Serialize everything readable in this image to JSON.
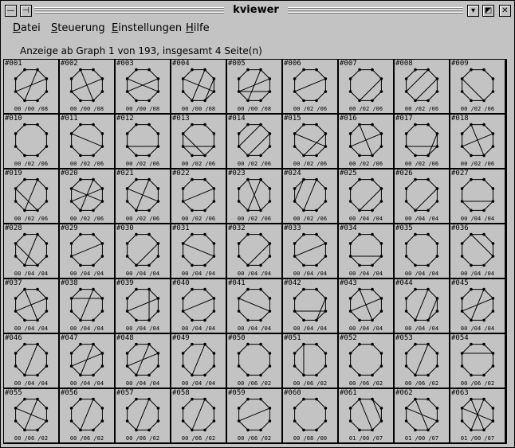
{
  "window": {
    "title": "kviewer"
  },
  "menu": [
    "Datei",
    "Steuerung",
    "Einstellungen",
    "Hilfe"
  ],
  "status": "Anzeige ab Graph 1 von 193, insgesamt 4 Seite(n)",
  "graphs": [
    {
      "label": "#001",
      "caption": "00 /00 /08",
      "edges": [
        [
          0,
          4
        ],
        [
          1,
          5
        ]
      ]
    },
    {
      "label": "#002",
      "caption": "00 /00 /08",
      "edges": [
        [
          1,
          5
        ],
        [
          3,
          7
        ]
      ]
    },
    {
      "label": "#003",
      "caption": "00 /00 /08",
      "edges": [
        [
          2,
          6
        ],
        [
          1,
          5
        ]
      ]
    },
    {
      "label": "#004",
      "caption": "00 /00 /08",
      "edges": [
        [
          0,
          4
        ],
        [
          2,
          6
        ],
        [
          1,
          3
        ]
      ]
    },
    {
      "label": "#005",
      "caption": "00 /00 /08",
      "edges": [
        [
          1,
          5
        ],
        [
          0,
          4
        ],
        [
          2,
          5
        ]
      ]
    },
    {
      "label": "#006",
      "caption": "00 /02 /06",
      "edges": [
        [
          1,
          5
        ]
      ]
    },
    {
      "label": "#007",
      "caption": "00 /02 /06",
      "edges": [
        [
          1,
          4
        ]
      ]
    },
    {
      "label": "#008",
      "caption": "00 /02 /06",
      "edges": [
        [
          1,
          4
        ],
        [
          0,
          5
        ]
      ]
    },
    {
      "label": "#009",
      "caption": "00 /02 /06",
      "edges": [
        [
          6,
          3
        ]
      ]
    },
    {
      "label": "#010",
      "caption": "00 /02 /06",
      "edges": []
    },
    {
      "label": "#011",
      "caption": "00 /02 /06",
      "edges": [
        [
          2,
          6
        ]
      ]
    },
    {
      "label": "#012",
      "caption": "00 /02 /06",
      "edges": [
        [
          2,
          5
        ]
      ]
    },
    {
      "label": "#013",
      "caption": "00 /02 /06",
      "edges": [
        [
          2,
          5
        ],
        [
          6,
          3
        ]
      ]
    },
    {
      "label": "#014",
      "caption": "00 /02 /06",
      "edges": [
        [
          0,
          5
        ],
        [
          1,
          4
        ]
      ]
    },
    {
      "label": "#015",
      "caption": "00 /02 /06",
      "edges": [
        [
          2,
          6
        ],
        [
          1,
          4
        ]
      ]
    },
    {
      "label": "#016",
      "caption": "00 /02 /06",
      "edges": [
        [
          1,
          5
        ],
        [
          7,
          3
        ]
      ]
    },
    {
      "label": "#017",
      "caption": "00 /02 /06",
      "edges": [
        [
          2,
          5
        ],
        [
          1,
          3
        ]
      ]
    },
    {
      "label": "#018",
      "caption": "00 /02 /06",
      "edges": [
        [
          1,
          5
        ],
        [
          7,
          3
        ]
      ]
    },
    {
      "label": "#019",
      "caption": "00 /02 /06",
      "edges": [
        [
          0,
          4
        ],
        [
          6,
          3
        ]
      ]
    },
    {
      "label": "#020",
      "caption": "00 /02 /06",
      "edges": [
        [
          2,
          6
        ],
        [
          1,
          5
        ],
        [
          0,
          4
        ]
      ]
    },
    {
      "label": "#021",
      "caption": "00 /02 /06",
      "edges": [
        [
          2,
          6
        ],
        [
          0,
          4
        ]
      ]
    },
    {
      "label": "#022",
      "caption": "00 /02 /06",
      "edges": [
        [
          1,
          5
        ]
      ]
    },
    {
      "label": "#023",
      "caption": "00 /02 /06",
      "edges": [
        [
          0,
          4
        ],
        [
          7,
          3
        ]
      ]
    },
    {
      "label": "#024",
      "caption": "00 /02 /06",
      "edges": [
        [
          0,
          4
        ],
        [
          7,
          5
        ]
      ]
    },
    {
      "label": "#025",
      "caption": "00 /04 /04",
      "edges": [
        [
          1,
          4
        ]
      ]
    },
    {
      "label": "#026",
      "caption": "00 /04 /04",
      "edges": [
        [
          1,
          4
        ]
      ]
    },
    {
      "label": "#027",
      "caption": "00 /04 /04",
      "edges": [
        [
          2,
          5
        ]
      ]
    },
    {
      "label": "#028",
      "caption": "00 /04 /04",
      "edges": [
        [
          0,
          4
        ],
        [
          6,
          3
        ]
      ]
    },
    {
      "label": "#029",
      "caption": "00 /04 /04",
      "edges": [
        [
          1,
          5
        ]
      ]
    },
    {
      "label": "#030",
      "caption": "00 /04 /04",
      "edges": [
        [
          1,
          4
        ]
      ]
    },
    {
      "label": "#031",
      "caption": "00 /04 /04",
      "edges": [
        [
          2,
          6
        ]
      ]
    },
    {
      "label": "#032",
      "caption": "00 /04 /04",
      "edges": [
        [
          1,
          4
        ]
      ]
    },
    {
      "label": "#033",
      "caption": "00 /04 /04",
      "edges": [
        [
          1,
          5
        ]
      ]
    },
    {
      "label": "#034",
      "caption": "00 /04 /04",
      "edges": [
        [
          2,
          5
        ]
      ]
    },
    {
      "label": "#035",
      "caption": "00 /04 /04",
      "edges": []
    },
    {
      "label": "#036",
      "caption": "00 /04 /04",
      "edges": [
        [
          7,
          2
        ]
      ]
    },
    {
      "label": "#037",
      "caption": "00 /04 /04",
      "edges": [
        [
          1,
          5
        ],
        [
          7,
          3
        ]
      ]
    },
    {
      "label": "#038",
      "caption": "00 /04 /04",
      "edges": [
        [
          0,
          4
        ],
        [
          1,
          6
        ]
      ]
    },
    {
      "label": "#039",
      "caption": "00 /04 /04",
      "edges": [
        [
          1,
          5
        ],
        [
          0,
          3
        ]
      ]
    },
    {
      "label": "#040",
      "caption": "00 /04 /04",
      "edges": [
        [
          1,
          5
        ]
      ]
    },
    {
      "label": "#041",
      "caption": "00 /04 /04",
      "edges": [
        [
          2,
          6
        ]
      ]
    },
    {
      "label": "#042",
      "caption": "00 /04 /04",
      "edges": [
        [
          2,
          5
        ],
        [
          1,
          3
        ]
      ]
    },
    {
      "label": "#043",
      "caption": "00 /04 /04",
      "edges": [
        [
          1,
          5
        ],
        [
          7,
          3
        ]
      ]
    },
    {
      "label": "#044",
      "caption": "00 /04 /04",
      "edges": [
        [
          0,
          4
        ],
        [
          1,
          3
        ]
      ]
    },
    {
      "label": "#045",
      "caption": "00 /04 /04",
      "edges": [
        [
          0,
          4
        ],
        [
          1,
          5
        ]
      ]
    },
    {
      "label": "#046",
      "caption": "00 /04 /04",
      "edges": [
        [
          0,
          4
        ]
      ]
    },
    {
      "label": "#047",
      "caption": "00 /04 /04",
      "edges": [
        [
          1,
          5
        ],
        [
          0,
          4
        ]
      ]
    },
    {
      "label": "#048",
      "caption": "00 /04 /04",
      "edges": [
        [
          0,
          4
        ],
        [
          1,
          5
        ]
      ]
    },
    {
      "label": "#049",
      "caption": "00 /04 /04",
      "edges": [
        [
          0,
          4
        ]
      ]
    },
    {
      "label": "#050",
      "caption": "00 /06 /02",
      "edges": []
    },
    {
      "label": "#051",
      "caption": "00 /06 /02",
      "edges": [
        [
          7,
          4
        ]
      ]
    },
    {
      "label": "#052",
      "caption": "00 /06 /02",
      "edges": []
    },
    {
      "label": "#053",
      "caption": "00 /06 /02",
      "edges": [
        [
          0,
          4
        ]
      ]
    },
    {
      "label": "#054",
      "caption": "00 /06 /02",
      "edges": [
        [
          1,
          6
        ]
      ]
    },
    {
      "label": "#055",
      "caption": "00 /06 /02",
      "edges": [
        [
          0,
          4
        ],
        [
          2,
          6
        ]
      ]
    },
    {
      "label": "#056",
      "caption": "00 /06 /02",
      "edges": [
        [
          0,
          4
        ]
      ]
    },
    {
      "label": "#057",
      "caption": "00 /06 /02",
      "edges": [
        [
          0,
          4
        ]
      ]
    },
    {
      "label": "#058",
      "caption": "00 /06 /02",
      "edges": [
        [
          0,
          4
        ]
      ]
    },
    {
      "label": "#059",
      "caption": "00 /06 /02",
      "edges": [
        [
          1,
          5
        ]
      ]
    },
    {
      "label": "#060",
      "caption": "00 /08 /00",
      "edges": []
    },
    {
      "label": "#061",
      "caption": "01 /00 /07",
      "edges": [
        [
          0,
          2
        ],
        [
          7,
          3
        ]
      ]
    },
    {
      "label": "#062",
      "caption": "01 /00 /07",
      "edges": [
        [
          6,
          2
        ],
        [
          7,
          3
        ]
      ]
    },
    {
      "label": "#063",
      "caption": "01 /00 /07",
      "edges": [
        [
          6,
          2
        ],
        [
          7,
          3
        ],
        [
          0,
          4
        ]
      ]
    }
  ]
}
